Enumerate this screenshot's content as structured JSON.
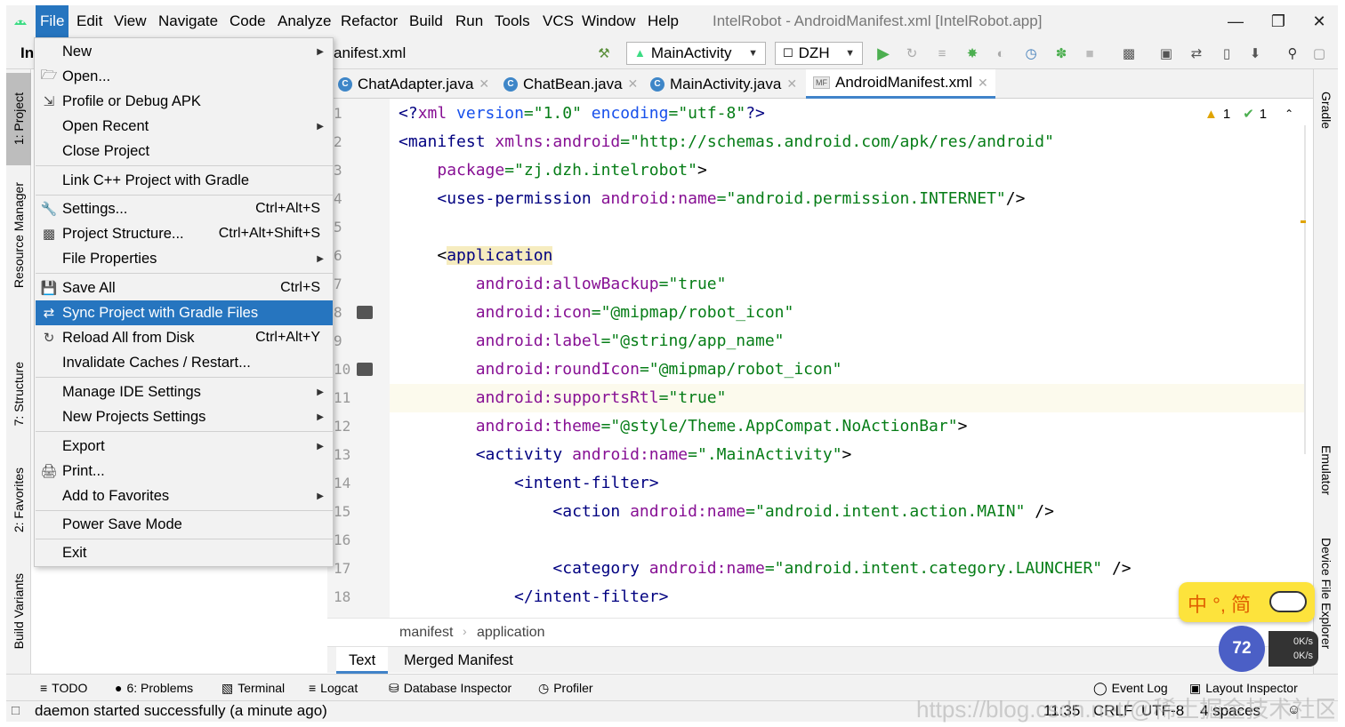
{
  "menubar": {
    "items": [
      "File",
      "Edit",
      "View",
      "Navigate",
      "Code",
      "Analyze",
      "Refactor",
      "Build",
      "Run",
      "Tools",
      "VCS",
      "Window",
      "Help"
    ],
    "title": "IntelRobot - AndroidManifest.xml [IntelRobot.app]"
  },
  "navbar": {
    "project_short": "In",
    "file_crumb": "anifest.xml",
    "run_config": "MainActivity",
    "device": "DZH"
  },
  "left_strip": [
    "1: Project",
    "Resource Manager",
    "7: Structure",
    "2: Favorites",
    "Build Variants"
  ],
  "right_strip": [
    "Gradle",
    "Emulator",
    "Device File Explorer"
  ],
  "tabs": [
    "ChatAdapter.java",
    "ChatBean.java",
    "MainActivity.java",
    "AndroidManifest.xml"
  ],
  "editor": {
    "line_numbers": [
      "1",
      "2",
      "3",
      "4",
      "5",
      "6",
      "7",
      "8",
      "9",
      "10",
      "11",
      "12",
      "13",
      "14",
      "15",
      "16",
      "17",
      "18"
    ],
    "inspection": {
      "warnings": "1",
      "ok": "1"
    }
  },
  "file_menu": {
    "items": [
      {
        "label": "New",
        "shortcut": "",
        "submenu": true,
        "icon": ""
      },
      {
        "label": "Open...",
        "shortcut": "",
        "submenu": false,
        "icon": "folder-icon"
      },
      {
        "label": "Profile or Debug APK",
        "shortcut": "",
        "submenu": false,
        "icon": "profile-icon"
      },
      {
        "label": "Open Recent",
        "shortcut": "",
        "submenu": true,
        "icon": ""
      },
      {
        "label": "Close Project",
        "shortcut": "",
        "submenu": false,
        "icon": ""
      },
      {
        "label": "Link C++ Project with Gradle",
        "shortcut": "",
        "submenu": false,
        "icon": ""
      },
      {
        "label": "Settings...",
        "shortcut": "Ctrl+Alt+S",
        "submenu": false,
        "icon": "wrench-icon"
      },
      {
        "label": "Project Structure...",
        "shortcut": "Ctrl+Alt+Shift+S",
        "submenu": false,
        "icon": "structure-icon"
      },
      {
        "label": "File Properties",
        "shortcut": "",
        "submenu": true,
        "icon": ""
      },
      {
        "label": "Save All",
        "shortcut": "Ctrl+S",
        "submenu": false,
        "icon": "save-icon"
      },
      {
        "label": "Sync Project with Gradle Files",
        "shortcut": "",
        "submenu": false,
        "icon": "gradle-sync-icon"
      },
      {
        "label": "Reload All from Disk",
        "shortcut": "Ctrl+Alt+Y",
        "submenu": false,
        "icon": "reload-icon"
      },
      {
        "label": "Invalidate Caches / Restart...",
        "shortcut": "",
        "submenu": false,
        "icon": ""
      },
      {
        "label": "Manage IDE Settings",
        "shortcut": "",
        "submenu": true,
        "icon": ""
      },
      {
        "label": "New Projects Settings",
        "shortcut": "",
        "submenu": true,
        "icon": ""
      },
      {
        "label": "Export",
        "shortcut": "",
        "submenu": true,
        "icon": ""
      },
      {
        "label": "Print...",
        "shortcut": "",
        "submenu": false,
        "icon": "print-icon"
      },
      {
        "label": "Add to Favorites",
        "shortcut": "",
        "submenu": true,
        "icon": ""
      },
      {
        "label": "Power Save Mode",
        "shortcut": "",
        "submenu": false,
        "icon": ""
      },
      {
        "label": "Exit",
        "shortcut": "",
        "submenu": false,
        "icon": ""
      }
    ],
    "highlighted": "Sync Project with Gradle Files"
  },
  "breadcrumb": [
    "manifest",
    "application"
  ],
  "bottom_tabs": [
    "Text",
    "Merged Manifest"
  ],
  "tool_windows": {
    "left": [
      "TODO",
      "6: Problems",
      "Terminal",
      "Logcat",
      "Database Inspector",
      "Profiler"
    ],
    "right": [
      "Event Log",
      "Layout Inspector"
    ]
  },
  "status": {
    "message": "daemon started successfully (a minute ago)",
    "position": "11:35",
    "line_sep": "CRLF",
    "encoding": "UTF-8",
    "indent": "4 spaces"
  },
  "ime": {
    "text": "中 °, 简"
  },
  "netmon": {
    "percent": "72",
    "up": "0K/s",
    "down": "0K/s"
  },
  "watermark": "https://blog.csdn.net/@稀土掘金技术社区",
  "colors": {
    "accent": "#2675bf",
    "tag": "#000080",
    "attr": "#871094",
    "string": "#067d17"
  }
}
